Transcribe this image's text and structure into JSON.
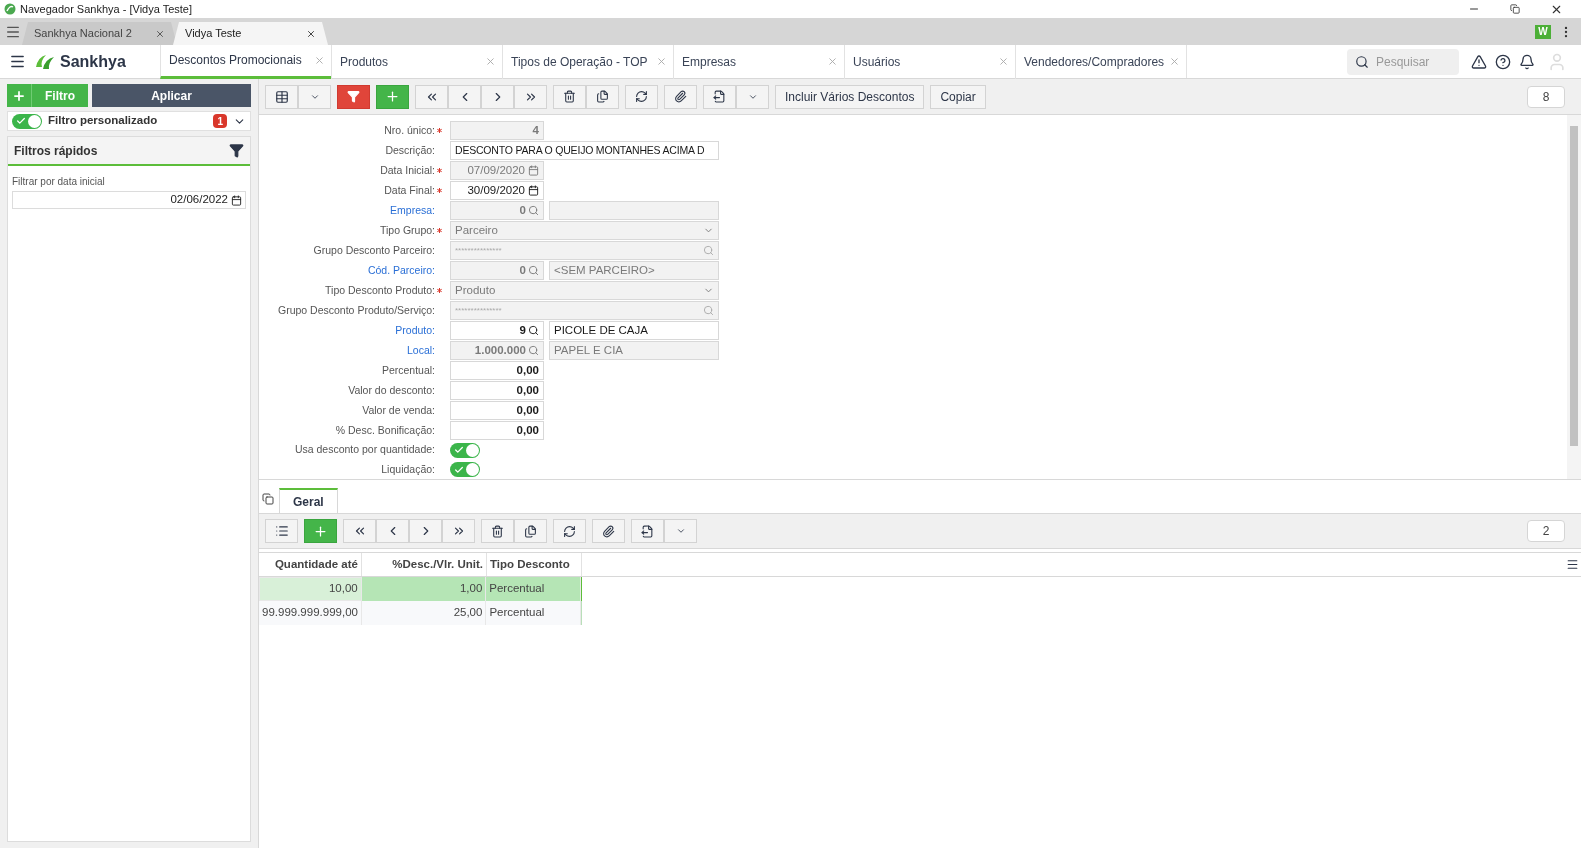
{
  "window": {
    "title": "Navegador Sankhya - [Vidya Teste]"
  },
  "browser_tabs": [
    {
      "label": "Sankhya Nacional 2",
      "selected": false
    },
    {
      "label": "Vidya Teste",
      "selected": true
    }
  ],
  "extension_label": "W",
  "app_header": {
    "logo_text": "Sankhya",
    "search": {
      "placeholder": "Pesquisar"
    }
  },
  "screen_tabs": [
    {
      "label": "Descontos Promocionais",
      "selected": true
    },
    {
      "label": "Produtos",
      "selected": false
    },
    {
      "label": "Tipos de Operação - TOP",
      "selected": false
    },
    {
      "label": "Empresas",
      "selected": false
    },
    {
      "label": "Usuários",
      "selected": false
    },
    {
      "label": "Vendedores/Compradores",
      "selected": false
    }
  ],
  "filter_panel": {
    "filter_button": "Filtro",
    "apply_button": "Aplicar",
    "custom_filter": {
      "label": "Filtro personalizado",
      "on": true,
      "count": "1"
    },
    "quick_filters_title": "Filtros rápidos",
    "date_filter": {
      "label": "Filtrar por data inicial",
      "value": "02/06/2022"
    }
  },
  "toolbar": {
    "buttons": [
      "Incluir Vários Descontos",
      "Copiar"
    ],
    "record_count": "8"
  },
  "form": [
    {
      "kind": "text",
      "label": "Nro. único:",
      "required": true,
      "link": false,
      "disabled": true,
      "value": "4"
    },
    {
      "kind": "wide",
      "label": "Descrição:",
      "required": false,
      "link": false,
      "disabled": false,
      "value": "DESCONTO PARA O QUEIJO MONTANHES ACIMA D"
    },
    {
      "kind": "date",
      "label": "Data Inicial:",
      "required": true,
      "link": false,
      "disabled": true,
      "value": "07/09/2020"
    },
    {
      "kind": "date",
      "label": "Data Final:",
      "required": true,
      "link": false,
      "disabled": false,
      "value": "30/09/2020"
    },
    {
      "kind": "lookup",
      "label": "Empresa:",
      "required": false,
      "link": true,
      "disabled": true,
      "value": "0"
    },
    {
      "kind": "select",
      "label": "Tipo Grupo:",
      "required": true,
      "link": false,
      "disabled": true,
      "value": "Parceiro"
    },
    {
      "kind": "multi",
      "label": "Grupo Desconto Parceiro:",
      "required": false,
      "link": false,
      "disabled": true,
      "value": "***************"
    },
    {
      "kind": "lookup",
      "label": "Cód. Parceiro:",
      "required": false,
      "link": true,
      "disabled": true,
      "value": "0",
      "description": "<SEM PARCEIRO>"
    },
    {
      "kind": "select",
      "label": "Tipo Desconto Produto:",
      "required": true,
      "link": false,
      "disabled": true,
      "value": "Produto"
    },
    {
      "kind": "multi",
      "label": "Grupo Desconto Produto/Serviço:",
      "required": false,
      "link": false,
      "disabled": true,
      "value": "***************"
    },
    {
      "kind": "lookup",
      "label": "Produto:",
      "required": false,
      "link": true,
      "disabled": false,
      "value": "9",
      "description": "PICOLE DE CAJA"
    },
    {
      "kind": "lookup",
      "label": "Local:",
      "required": false,
      "link": true,
      "disabled": true,
      "value": "1.000.000",
      "description": "PAPEL E CIA"
    },
    {
      "kind": "text",
      "label": "Percentual:",
      "required": false,
      "link": false,
      "disabled": false,
      "value": "0,00"
    },
    {
      "kind": "text",
      "label": "Valor do desconto:",
      "required": false,
      "link": false,
      "disabled": false,
      "value": "0,00"
    },
    {
      "kind": "text",
      "label": "Valor de venda:",
      "required": false,
      "link": false,
      "disabled": false,
      "value": "0,00"
    },
    {
      "kind": "text",
      "label": "% Desc. Bonificação:",
      "required": false,
      "link": false,
      "disabled": false,
      "value": "0,00"
    },
    {
      "kind": "toggle",
      "label": "Usa desconto por quantidade:",
      "required": false,
      "link": false,
      "on": true
    },
    {
      "kind": "toggle",
      "label": "Liquidação:",
      "required": false,
      "link": false,
      "on": true
    }
  ],
  "detail": {
    "tabs": [
      {
        "label": "Geral",
        "selected": true
      }
    ],
    "record_count": "2",
    "table": {
      "columns": [
        "Quantidade até",
        "%Desc./Vlr. Unit.",
        "Tipo Desconto"
      ],
      "rows": [
        {
          "cells": [
            "10,00",
            "1,00",
            "Percentual"
          ],
          "selected": true
        },
        {
          "cells": [
            "99.999.999.999,00",
            "25,00",
            "Percentual"
          ],
          "selected": false
        }
      ]
    }
  }
}
